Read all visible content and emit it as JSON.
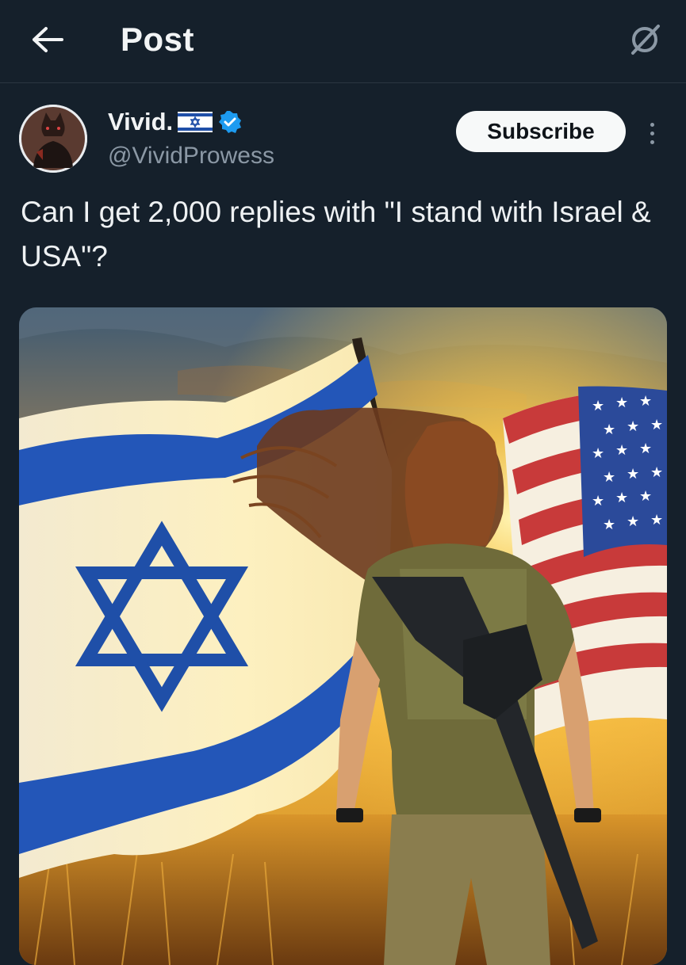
{
  "topbar": {
    "title": "Post",
    "back_icon": "arrow-left-icon",
    "grok_icon": "grok-icon"
  },
  "author": {
    "display_name": "Vivid.",
    "flag_icon": "israel-flag-icon",
    "verified_icon": "verified-badge-icon",
    "handle": "@VividProwess"
  },
  "actions": {
    "subscribe_label": "Subscribe",
    "more_icon": "more-vertical-icon"
  },
  "post": {
    "text": "Can I get 2,000 replies with \"I stand with Israel & USA\"?"
  },
  "colors": {
    "background": "#15202b",
    "verified": "#1d9bf0",
    "israel_blue": "#1f4fa8",
    "us_red": "#c83a3a",
    "us_blue": "#2b4a9a"
  }
}
